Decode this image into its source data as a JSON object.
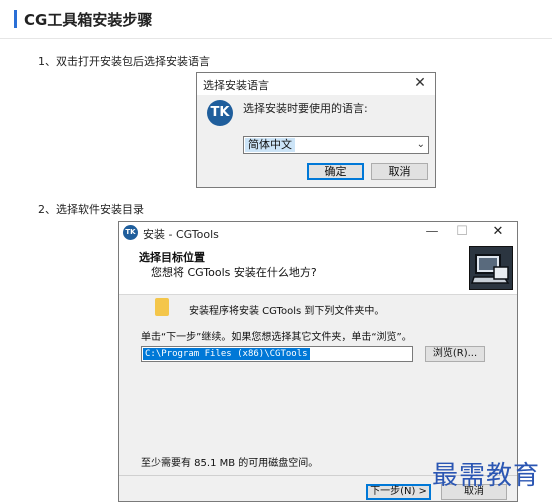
{
  "header": {
    "title": "CG工具箱安装步骤"
  },
  "steps": [
    {
      "text": "1、双击打开安装包后选择安装语言"
    },
    {
      "text": "2、选择软件安装目录"
    }
  ],
  "language_dialog": {
    "title": "选择安装语言",
    "close_glyph": "✕",
    "logo_text": "TK",
    "prompt": "选择安装时要使用的语言:",
    "selected_language": "简体中文",
    "ok_label": "确定",
    "cancel_label": "取消"
  },
  "setup_dialog": {
    "title": "安装 - CGTools",
    "logo_text": "TK",
    "minimize_glyph": "—",
    "maximize_glyph": "☐",
    "close_glyph": "✕",
    "heading": "选择目标位置",
    "subheading": "您想将 CGTools 安装在什么地方?",
    "folder_text": "安装程序将安装 CGTools 到下列文件夹中。",
    "instruction": "单击“下一步”继续。如果您想选择其它文件夹，单击“浏览”。",
    "install_path": "C:\\Program Files (x86)\\CGTools",
    "browse_label": "浏览(R)...",
    "disk_space": "至少需要有 85.1 MB 的可用磁盘空间。",
    "next_label": "下一步(N) >",
    "cancel_label": "取消"
  },
  "watermark": {
    "text": "最需教育"
  }
}
